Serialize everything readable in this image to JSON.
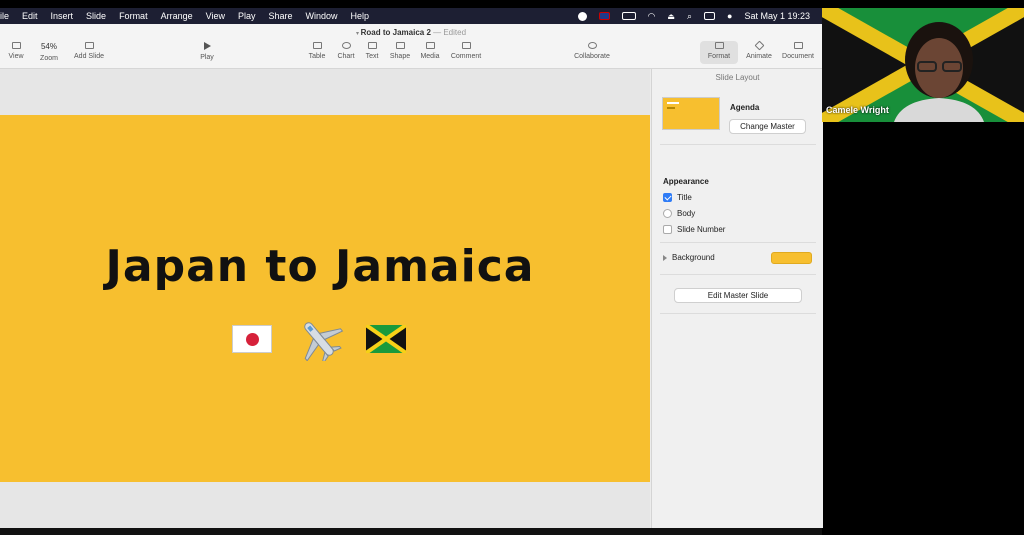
{
  "menubar": {
    "items": [
      "ile",
      "Edit",
      "Insert",
      "Slide",
      "Format",
      "Arrange",
      "View",
      "Play",
      "Share",
      "Window",
      "Help"
    ],
    "clock": "Sat May 1  19:23"
  },
  "document": {
    "title": "Road to Jamaica 2",
    "status": "— Edited"
  },
  "toolbar": {
    "view": "View",
    "zoom_value": "54%",
    "zoom": "Zoom",
    "add_slide": "Add Slide",
    "play": "Play",
    "table": "Table",
    "chart": "Chart",
    "text": "Text",
    "shape": "Shape",
    "media": "Media",
    "comment": "Comment",
    "collaborate": "Collaborate",
    "format": "Format",
    "animate": "Animate",
    "document": "Document"
  },
  "slide": {
    "title": "Japan to Jamaica",
    "background_color": "#f7bf2f"
  },
  "panel": {
    "header": "Slide Layout",
    "master_name": "Agenda",
    "change_master": "Change Master",
    "appearance": "Appearance",
    "options": [
      {
        "label": "Title",
        "checked": true
      },
      {
        "label": "Body",
        "checked": false
      },
      {
        "label": "Slide Number",
        "checked": false
      }
    ],
    "background": "Background",
    "edit_master": "Edit Master Slide"
  },
  "video": {
    "participant": "Camele Wright"
  }
}
